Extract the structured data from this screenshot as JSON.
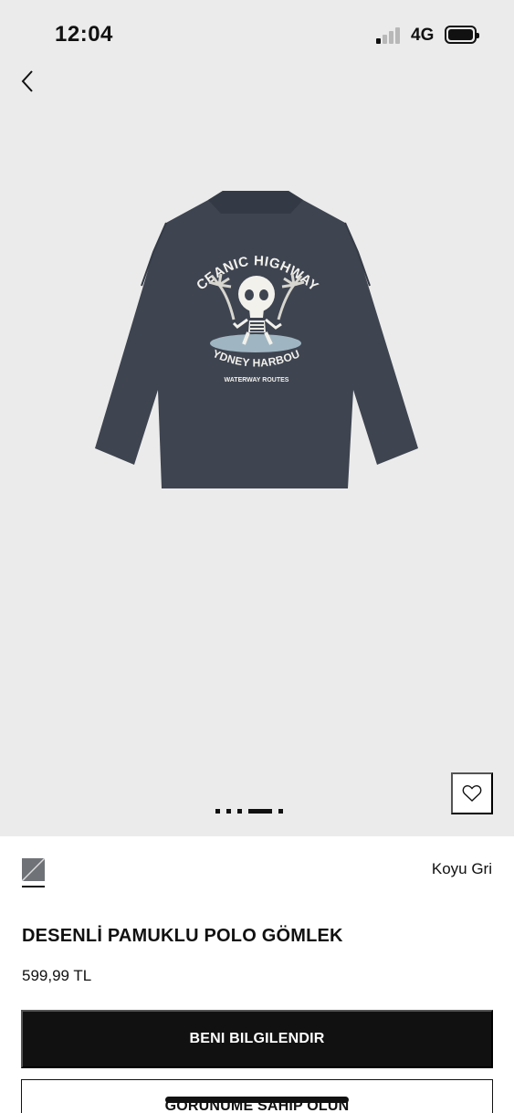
{
  "status_bar": {
    "time": "12:04",
    "network": "4G",
    "signal_bars_active": 1,
    "signal_bars_total": 4,
    "battery_level": 1.0
  },
  "navigation": {
    "back_icon": "chevron-left-icon"
  },
  "gallery": {
    "image_alt": "Product image",
    "print_text": {
      "line1": "OCEANIC HIGHWAYS",
      "line2": "SYDNEY HARBOUR",
      "line3": "WATERWAY ROUTES"
    },
    "favorite_icon": "heart-icon",
    "page_count": 5,
    "active_page": 4
  },
  "product": {
    "color_name": "Koyu Gri",
    "swatch_color": "#6f7276",
    "title": "DESENLİ PAMUKLU POLO GÖMLEK",
    "price": "599,99 TL"
  },
  "actions": {
    "notify_label": "BENI BILGILENDIR",
    "secondary_label": "GÖRÜNÜME SAHİP OLUN"
  },
  "colors": {
    "background": "#ebebeb",
    "garment": "#3e4450",
    "primary_button": "#111111"
  }
}
